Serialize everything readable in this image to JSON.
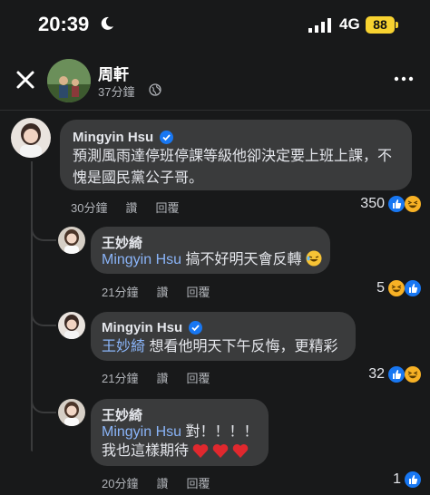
{
  "status_bar": {
    "time": "20:39",
    "network": "4G",
    "battery": "88"
  },
  "header": {
    "name": "周軒",
    "time": "37分鐘"
  },
  "actions": {
    "like": "讚",
    "reply": "回覆"
  },
  "comments": [
    {
      "author": "Mingyin Hsu",
      "line1": "預測風雨達停班停課等級他卻決定要上班上課，不",
      "line2": "愧是國民黨公子哥。",
      "time": "30分鐘",
      "reactions": "350"
    },
    {
      "author": "王妙綺",
      "mention": "Mingyin Hsu",
      "text": "搞不好明天會反轉",
      "time": "21分鐘",
      "reactions": "5"
    },
    {
      "author": "Mingyin Hsu",
      "mention": "王妙綺",
      "text": "想看他明天下午反悔，更精彩",
      "time": "21分鐘",
      "reactions": "32"
    },
    {
      "author": "王妙綺",
      "mention": "Mingyin Hsu",
      "text": "對！！！！",
      "line2": "我也這樣期待",
      "time": "20分鐘",
      "reactions": "1"
    }
  ],
  "colors": {
    "background": "#18191a",
    "bubble": "#3a3b3c",
    "mention": "#8ab4f8",
    "like": "#1877f2",
    "haha": "#f7b125",
    "love": "#f33e58",
    "battery": "#f7d230"
  }
}
